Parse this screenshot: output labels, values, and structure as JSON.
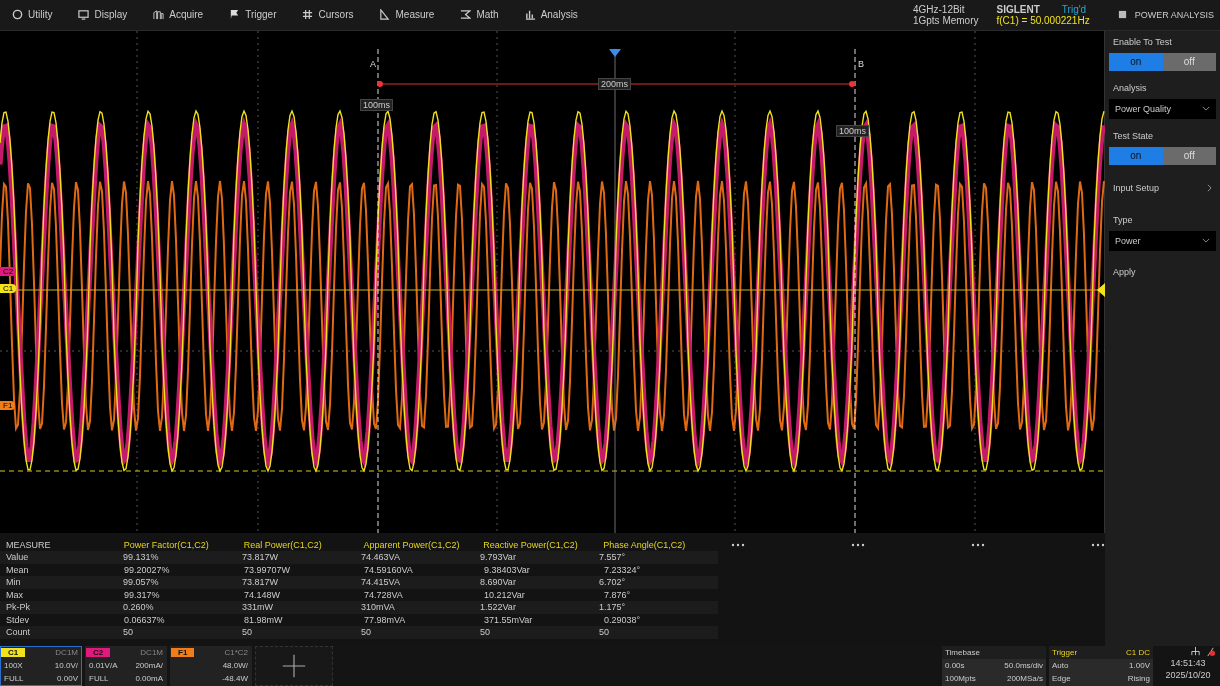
{
  "menu": [
    {
      "label": "Utility",
      "kind": "utility"
    },
    {
      "label": "Display",
      "kind": "display"
    },
    {
      "label": "Acquire",
      "kind": "acquire"
    },
    {
      "label": "Trigger",
      "kind": "trigger"
    },
    {
      "label": "Cursors",
      "kind": "cursors"
    },
    {
      "label": "Measure",
      "kind": "measure"
    },
    {
      "label": "Math",
      "kind": "math"
    },
    {
      "label": "Analysis",
      "kind": "analysis"
    }
  ],
  "status": {
    "spec": "4GHz-12Bit",
    "memory": "1Gpts Memory",
    "brand": "SIGLENT",
    "trig_state": "Trig'd",
    "frequency": "f(C1) = 50.000221Hz"
  },
  "panel_title": "POWER ANALYSIS",
  "plot": {
    "cursor_a": "A",
    "cursor_b": "B",
    "delta": "200ms",
    "a_time": "100ms",
    "b_time": "100ms",
    "markers": [
      {
        "label": "C2",
        "color": "#e0197d"
      },
      {
        "label": "C1",
        "color": "#f2e21c"
      },
      {
        "label": "F1",
        "color": "#f07d1a"
      }
    ]
  },
  "settings": [
    {
      "kind": "toggle",
      "label": "Enable To Test",
      "options": [
        {
          "label": "on",
          "selected": true
        },
        {
          "label": "off",
          "selected": false
        }
      ]
    },
    {
      "kind": "dropdown",
      "label": "Analysis",
      "value": "Power Quality"
    },
    {
      "kind": "toggle",
      "label": "Test State",
      "options": [
        {
          "label": "on",
          "selected": true
        },
        {
          "label": "off",
          "selected": false
        }
      ]
    },
    {
      "kind": "link",
      "label": "Input Setup"
    },
    {
      "kind": "dropdown",
      "label": "Type",
      "value": "Power"
    },
    {
      "kind": "action",
      "label": "Apply"
    }
  ],
  "measure": {
    "columns": [
      "MEASURE",
      "Power Factor(C1,C2)",
      "Real Power(C1,C2)",
      "Apparent Power(C1,C2)",
      "Reactive Power(C1,C2)",
      "Phase Angle(C1,C2)"
    ],
    "rows": [
      [
        "Value",
        "99.131%",
        "73.817W",
        "74.463VA",
        "9.793Var",
        "7.557°"
      ],
      [
        "Mean",
        "99.20027%",
        "73.99707W",
        "74.59160VA",
        "9.38403Var",
        "7.23324°"
      ],
      [
        "Min",
        "99.057%",
        "73.817W",
        "74.415VA",
        "8.690Var",
        "6.702°"
      ],
      [
        "Max",
        "99.317%",
        "74.148W",
        "74.728VA",
        "10.212Var",
        "7.876°"
      ],
      [
        "Pk-Pk",
        "0.260%",
        "331mW",
        "310mVA",
        "1.522Var",
        "1.175°"
      ],
      [
        "Stdev",
        "0.06637%",
        "81.98mW",
        "77.98mVA",
        "371.55mVar",
        "0.29038°"
      ],
      [
        "Count",
        "50",
        "50",
        "50",
        "50",
        "50"
      ]
    ]
  },
  "channels": [
    {
      "name": "C1",
      "coupling": "DC1M",
      "color": "#f2e21c",
      "selected": true,
      "lines": [
        {
          "label": "100X",
          "value": "10.0V/"
        },
        {
          "label": "FULL",
          "value": "0.00V"
        }
      ]
    },
    {
      "name": "C2",
      "coupling": "DC1M",
      "color": "#e0197d",
      "selected": false,
      "lines": [
        {
          "label": "0.01V/A",
          "value": "200mA/"
        },
        {
          "label": "FULL",
          "value": "0.00mA"
        }
      ]
    },
    {
      "name": "F1",
      "coupling": "C1*C2",
      "color": "#f07d1a",
      "selected": false,
      "lines": [
        {
          "value": "48.0W/"
        },
        {
          "value": "-48.4W"
        }
      ]
    }
  ],
  "timebase": {
    "title": "Timebase",
    "lines": [
      [
        "0.00s",
        "50.0ms/div"
      ],
      [
        "100Mpts",
        "200MSa/s"
      ]
    ]
  },
  "trigger": {
    "title": "Trigger",
    "source": "C1 DC",
    "lines": [
      [
        "Auto",
        "1.00V"
      ],
      [
        "Edge",
        "Rising"
      ]
    ]
  },
  "clock": {
    "time": "14:51:43",
    "date": "2025/10/20"
  }
}
